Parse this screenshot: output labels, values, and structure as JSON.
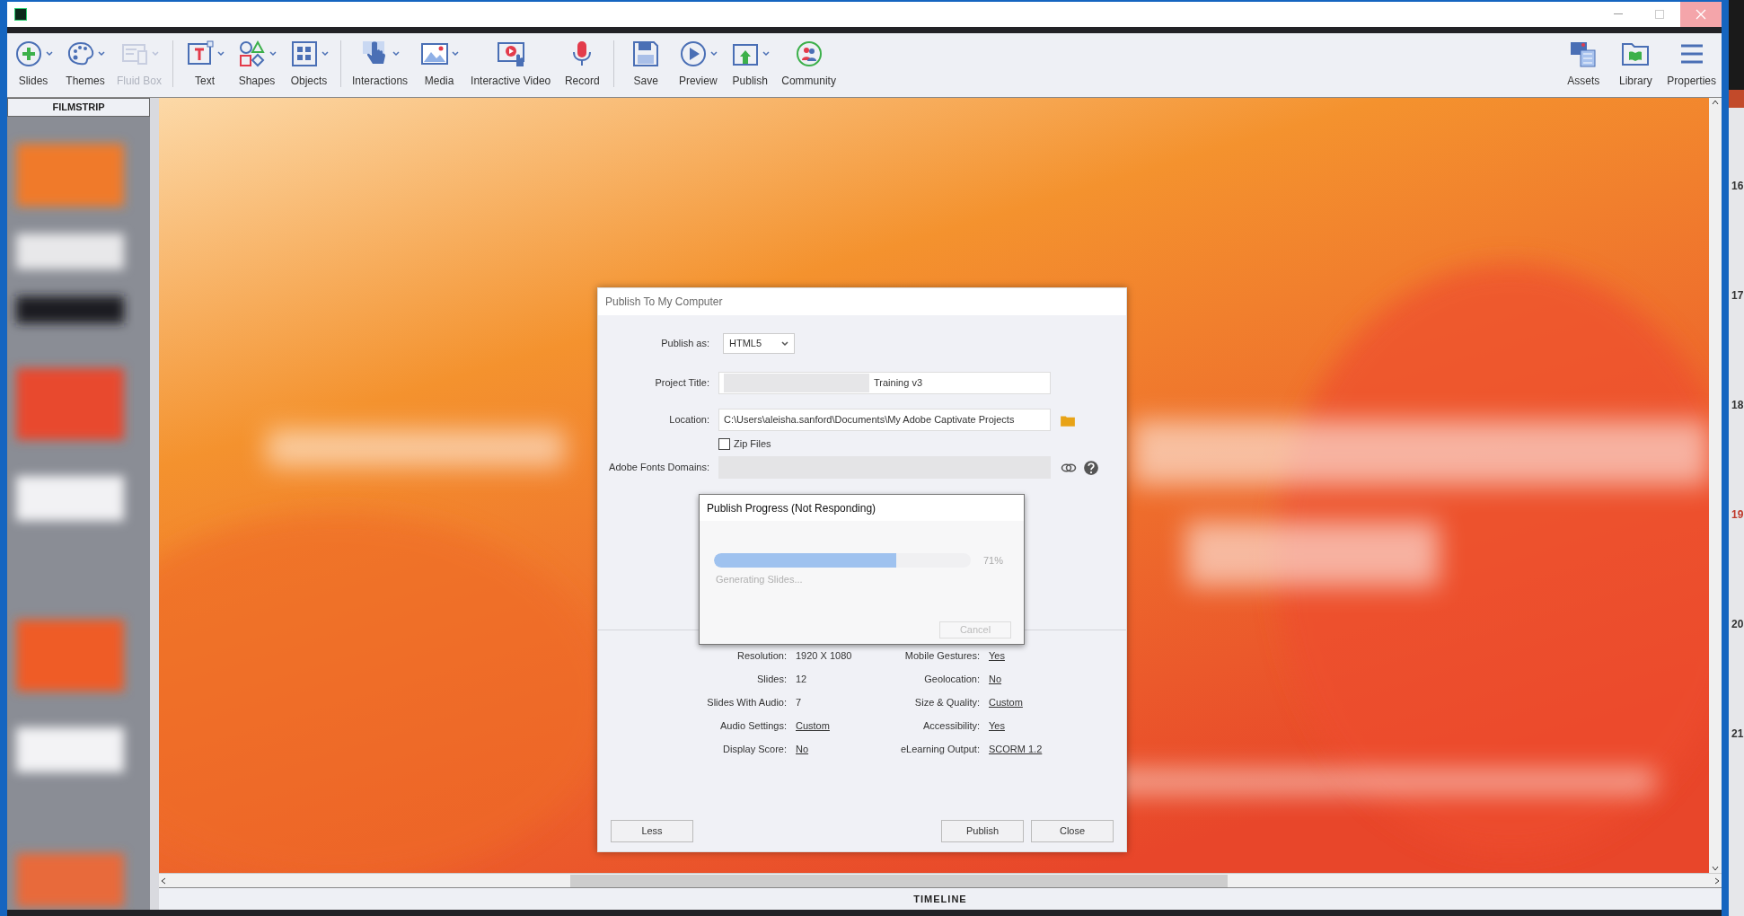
{
  "toolbar": {
    "groups": [
      {
        "items": [
          {
            "label": "Slides",
            "dropdown": true,
            "disabled": false
          },
          {
            "label": "Themes",
            "dropdown": true,
            "disabled": false
          },
          {
            "label": "Fluid Box",
            "dropdown": true,
            "disabled": true
          }
        ]
      },
      {
        "items": [
          {
            "label": "Text",
            "dropdown": true,
            "disabled": false
          },
          {
            "label": "Shapes",
            "dropdown": true,
            "disabled": false
          },
          {
            "label": "Objects",
            "dropdown": true,
            "disabled": false
          }
        ]
      },
      {
        "items": [
          {
            "label": "Interactions",
            "dropdown": true,
            "disabled": false
          },
          {
            "label": "Media",
            "dropdown": true,
            "disabled": false
          },
          {
            "label": "Interactive Video",
            "dropdown": false,
            "disabled": false
          },
          {
            "label": "Record",
            "dropdown": false,
            "disabled": false
          }
        ]
      },
      {
        "items": [
          {
            "label": "Save",
            "dropdown": false,
            "disabled": false
          },
          {
            "label": "Preview",
            "dropdown": true,
            "disabled": false
          },
          {
            "label": "Publish",
            "dropdown": true,
            "disabled": false
          },
          {
            "label": "Community",
            "dropdown": false,
            "disabled": false
          }
        ]
      }
    ],
    "right": [
      {
        "label": "Assets"
      },
      {
        "label": "Library"
      },
      {
        "label": "Properties"
      }
    ]
  },
  "filmstrip": {
    "title": "FILMSTRIP"
  },
  "dialog": {
    "title": "Publish To My Computer",
    "publish_as": {
      "label": "Publish as:",
      "value": "HTML5"
    },
    "project_title": {
      "label": "Project Title:",
      "value": "Training v3"
    },
    "location": {
      "label": "Location:",
      "value": "C:\\Users\\aleisha.sanford\\Documents\\My Adobe Captivate Projects"
    },
    "zip_files": {
      "label": "Zip Files",
      "checked": false
    },
    "fonts_domains": {
      "label": "Adobe Fonts Domains:"
    },
    "summary_left": [
      {
        "label": "Resolution:",
        "value": "1920 X 1080",
        "link": false
      },
      {
        "label": "Slides:",
        "value": "12",
        "link": false
      },
      {
        "label": "Slides With Audio:",
        "value": "7",
        "link": false
      },
      {
        "label": "Audio Settings:",
        "value": "Custom",
        "link": true
      },
      {
        "label": "Display Score:",
        "value": "No",
        "link": true
      }
    ],
    "summary_right": [
      {
        "label": "Mobile Gestures:",
        "value": "Yes",
        "link": true
      },
      {
        "label": "Geolocation:",
        "value": "No",
        "link": true
      },
      {
        "label": "Size & Quality:",
        "value": "Custom",
        "link": true
      },
      {
        "label": "Accessibility:",
        "value": "Yes",
        "link": true
      },
      {
        "label": "eLearning Output:",
        "value": "SCORM 1.2",
        "link": true
      }
    ],
    "buttons": [
      "Less",
      "Publish",
      "Close"
    ]
  },
  "progress": {
    "title": "Publish Progress (Not Responding)",
    "level": 0.71,
    "percent": "71%",
    "status": "Generating Slides...",
    "cancel": {
      "label": "Cancel",
      "disabled": true
    }
  },
  "timeline": {
    "title": "TIMELINE"
  },
  "side_panel": {
    "rows": [
      {
        "label": "16",
        "color": "#333333"
      },
      {
        "label": "17",
        "color": "#333333"
      },
      {
        "label": "18",
        "color": "#333333"
      },
      {
        "label": "19",
        "color": "#c0392b"
      },
      {
        "label": "20",
        "color": "#333333"
      },
      {
        "label": "21",
        "color": "#333333"
      }
    ]
  }
}
